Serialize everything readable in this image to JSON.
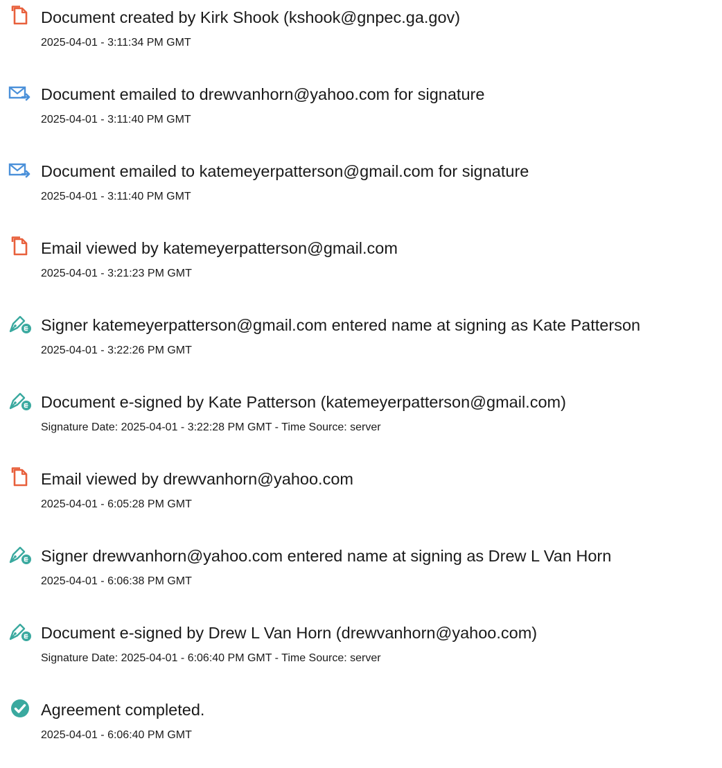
{
  "colors": {
    "doc_icon": "#e8603c",
    "email_icon": "#4a90d9",
    "sign_icon": "#3aa99f",
    "complete_icon": "#3aa99f"
  },
  "events": [
    {
      "icon": "document-icon",
      "title": "Document created by Kirk Shook (kshook@gnpec.ga.gov)",
      "meta": "2025-04-01 - 3:11:34 PM GMT"
    },
    {
      "icon": "email-sent-icon",
      "title": "Document emailed to drewvanhorn@yahoo.com for signature",
      "meta": "2025-04-01 - 3:11:40 PM GMT"
    },
    {
      "icon": "email-sent-icon",
      "title": "Document emailed to katemeyerpatterson@gmail.com for signature",
      "meta": "2025-04-01 - 3:11:40 PM GMT"
    },
    {
      "icon": "document-icon",
      "title": "Email viewed by katemeyerpatterson@gmail.com",
      "meta": "2025-04-01 - 3:21:23 PM GMT"
    },
    {
      "icon": "pen-sign-icon",
      "title": "Signer katemeyerpatterson@gmail.com entered name at signing as Kate Patterson",
      "meta": "2025-04-01 - 3:22:26 PM GMT"
    },
    {
      "icon": "pen-sign-icon",
      "title": "Document e-signed by Kate Patterson (katemeyerpatterson@gmail.com)",
      "meta": "Signature Date: 2025-04-01 - 3:22:28 PM GMT - Time Source: server"
    },
    {
      "icon": "document-icon",
      "title": "Email viewed by drewvanhorn@yahoo.com",
      "meta": "2025-04-01 - 6:05:28 PM GMT"
    },
    {
      "icon": "pen-sign-icon",
      "title": "Signer drewvanhorn@yahoo.com entered name at signing as Drew L Van Horn",
      "meta": "2025-04-01 - 6:06:38 PM GMT"
    },
    {
      "icon": "pen-sign-icon",
      "title": "Document e-signed by Drew L Van Horn (drewvanhorn@yahoo.com)",
      "meta": "Signature Date: 2025-04-01 - 6:06:40 PM GMT - Time Source: server"
    },
    {
      "icon": "checkmark-circle-icon",
      "title": "Agreement completed.",
      "meta": "2025-04-01 - 6:06:40 PM GMT"
    }
  ]
}
